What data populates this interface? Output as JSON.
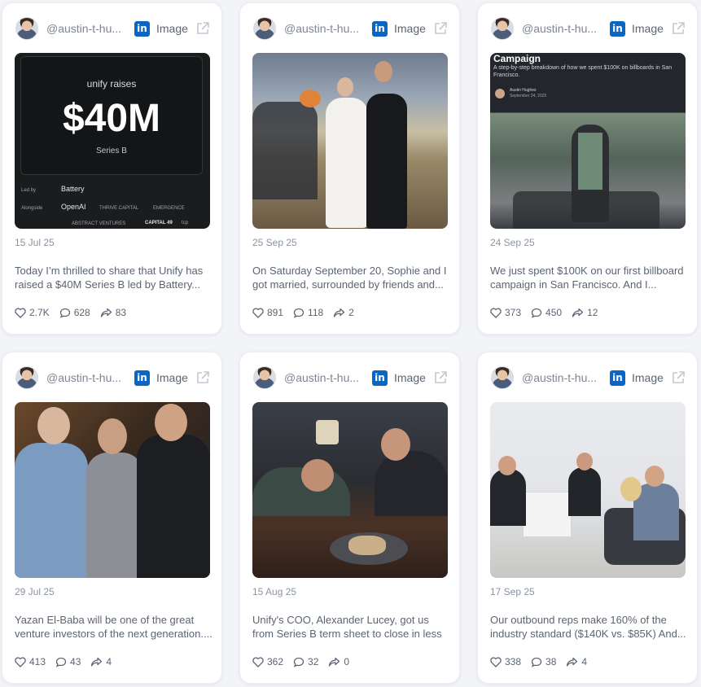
{
  "cards": [
    {
      "handle": "@austin-t-hu...",
      "type": "Image",
      "date": "15 Jul 25",
      "caption": "Today I’m thrilled to share that Unify has raised a $40M Series B led by Battery...",
      "likes": "2.7K",
      "comments": "628",
      "shares": "83",
      "media": {
        "brand": "unify raises",
        "amount": "$40M",
        "round": "Series B",
        "led_by_label": "Led by",
        "led_by": "Battery",
        "alongside_label": "Alongside",
        "investors": [
          "OpenAI",
          "THRIVE CAPITAL",
          "EMERGENCE",
          "ABSTRACT VENTURES",
          "CAPITAL 49",
          "tcp"
        ]
      }
    },
    {
      "handle": "@austin-t-hu...",
      "type": "Image",
      "date": "25 Sep 25",
      "caption": "On Saturday September 20, Sophie and I got married, surrounded by friends and...",
      "likes": "891",
      "comments": "118",
      "shares": "2"
    },
    {
      "handle": "@austin-t-hu...",
      "type": "Image",
      "date": "24 Sep 25",
      "caption": "We just spent $100K on our first billboard campaign in San Francisco. And I...",
      "likes": "373",
      "comments": "450",
      "shares": "12",
      "media": {
        "heading": "Campaign",
        "subheading": "A step-by-step breakdown of how we spent $100K on billboards in San Francisco.",
        "author": "Austin Hughes",
        "author_date": "September 24, 2025"
      }
    },
    {
      "handle": "@austin-t-hu...",
      "type": "Image",
      "date": "29 Jul 25",
      "caption": "Yazan El-Baba will be one of the great venture investors of the next generation....",
      "likes": "413",
      "comments": "43",
      "shares": "4"
    },
    {
      "handle": "@austin-t-hu...",
      "type": "Image",
      "date": "15 Aug 25",
      "caption": "Unify's COO, Alexander Lucey, got us from Series B term sheet to close in less than ...",
      "likes": "362",
      "comments": "32",
      "shares": "0"
    },
    {
      "handle": "@austin-t-hu...",
      "type": "Image",
      "date": "17 Sep 25",
      "caption": "Our outbound reps make 160% of the industry standard ($140K vs. $85K) And...",
      "likes": "338",
      "comments": "38",
      "shares": "4"
    }
  ],
  "colors": {
    "linkedin": "#0a66c2",
    "page_bg": "#f3f4f8",
    "text": "#5b6475"
  },
  "icons": [
    "avatar",
    "linkedin-icon",
    "external-link-icon",
    "heart-icon",
    "comment-icon",
    "share-icon"
  ]
}
